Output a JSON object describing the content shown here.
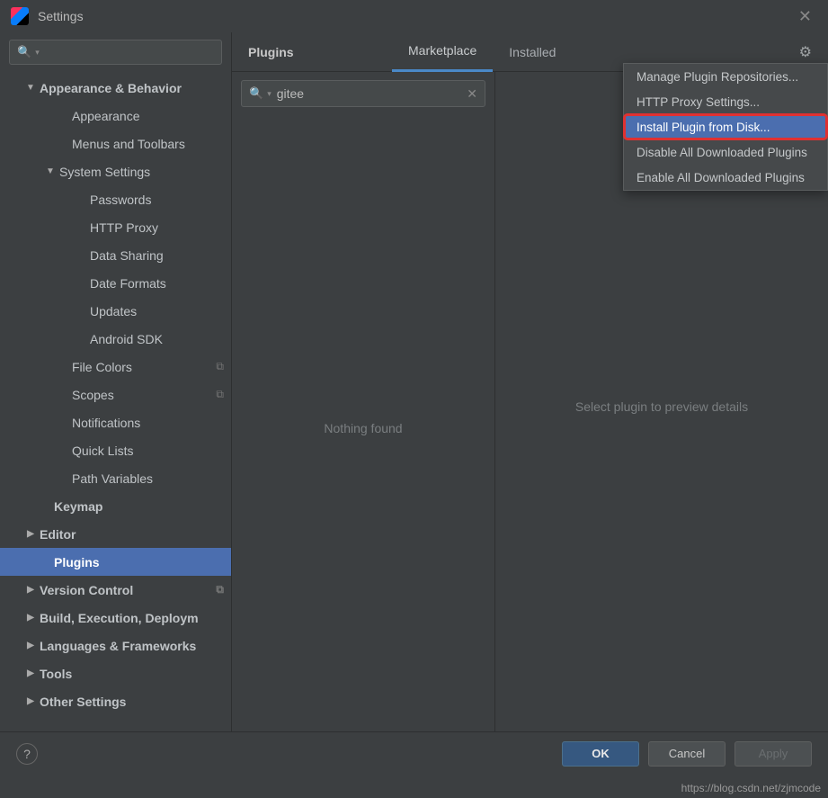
{
  "title": "Settings",
  "tabs": {
    "page_title": "Plugins",
    "marketplace": "Marketplace",
    "installed": "Installed"
  },
  "sidebar": {
    "items": [
      {
        "label": "Appearance & Behavior",
        "indent": 28,
        "arrow": "down",
        "bold": true
      },
      {
        "label": "Appearance",
        "indent": 64,
        "arrow": "none"
      },
      {
        "label": "Menus and Toolbars",
        "indent": 64,
        "arrow": "none"
      },
      {
        "label": "System Settings",
        "indent": 50,
        "arrow": "down"
      },
      {
        "label": "Passwords",
        "indent": 84,
        "arrow": "none"
      },
      {
        "label": "HTTP Proxy",
        "indent": 84,
        "arrow": "none"
      },
      {
        "label": "Data Sharing",
        "indent": 84,
        "arrow": "none"
      },
      {
        "label": "Date Formats",
        "indent": 84,
        "arrow": "none"
      },
      {
        "label": "Updates",
        "indent": 84,
        "arrow": "none"
      },
      {
        "label": "Android SDK",
        "indent": 84,
        "arrow": "none"
      },
      {
        "label": "File Colors",
        "indent": 64,
        "arrow": "none",
        "copy": true
      },
      {
        "label": "Scopes",
        "indent": 64,
        "arrow": "none",
        "copy": true
      },
      {
        "label": "Notifications",
        "indent": 64,
        "arrow": "none"
      },
      {
        "label": "Quick Lists",
        "indent": 64,
        "arrow": "none"
      },
      {
        "label": "Path Variables",
        "indent": 64,
        "arrow": "none"
      },
      {
        "label": "Keymap",
        "indent": 44,
        "arrow": "none",
        "bold": true
      },
      {
        "label": "Editor",
        "indent": 28,
        "arrow": "right",
        "bold": true
      },
      {
        "label": "Plugins",
        "indent": 44,
        "arrow": "none",
        "bold": true,
        "selected": true
      },
      {
        "label": "Version Control",
        "indent": 28,
        "arrow": "right",
        "bold": true,
        "copy": true
      },
      {
        "label": "Build, Execution, Deploym",
        "indent": 28,
        "arrow": "right",
        "bold": true
      },
      {
        "label": "Languages & Frameworks",
        "indent": 28,
        "arrow": "right",
        "bold": true
      },
      {
        "label": "Tools",
        "indent": 28,
        "arrow": "right",
        "bold": true
      },
      {
        "label": "Other Settings",
        "indent": 28,
        "arrow": "right",
        "bold": true
      }
    ]
  },
  "plugin_search": {
    "value": "gitee"
  },
  "empty_left": "Nothing found",
  "empty_right": "Select plugin to preview details",
  "context_menu": {
    "items": [
      {
        "label": "Manage Plugin Repositories..."
      },
      {
        "label": "HTTP Proxy Settings..."
      },
      {
        "label": "Install Plugin from Disk...",
        "highlighted": true
      },
      {
        "label": "Disable All Downloaded Plugins"
      },
      {
        "label": "Enable All Downloaded Plugins"
      }
    ]
  },
  "buttons": {
    "ok": "OK",
    "cancel": "Cancel",
    "apply": "Apply"
  },
  "watermark": "https://blog.csdn.net/zjmcode"
}
